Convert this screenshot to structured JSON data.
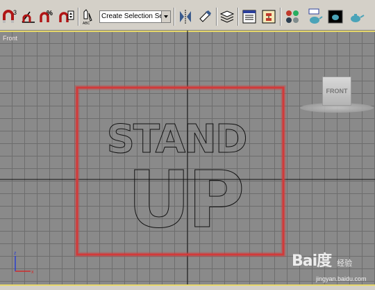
{
  "toolbar": {
    "buttons": [
      {
        "name": "snaps-toggle-3d",
        "icon": "snap-magnet-icon",
        "label": "3"
      },
      {
        "name": "angle-snap",
        "icon": "angle-snap-icon",
        "label": ""
      },
      {
        "name": "percent-snap",
        "icon": "percent-snap-icon",
        "label": "%"
      },
      {
        "name": "spinner-snap",
        "icon": "spinner-snap-icon",
        "label": ""
      },
      {
        "name": "named-selection",
        "icon": "abc-edit-named-selection-icon",
        "label": "ABC"
      },
      {
        "name": "mirror",
        "icon": "mirror-icon",
        "label": ""
      },
      {
        "name": "align",
        "icon": "align-icon",
        "label": ""
      },
      {
        "name": "layer-manager",
        "icon": "layers-icon",
        "label": ""
      },
      {
        "name": "curve-editor",
        "icon": "curve-editor-icon",
        "label": ""
      },
      {
        "name": "schematic-view",
        "icon": "schematic-view-icon",
        "label": ""
      },
      {
        "name": "material-editor",
        "icon": "material-editor-icon",
        "label": ""
      },
      {
        "name": "render-setup",
        "icon": "render-setup-teapot-icon",
        "label": ""
      },
      {
        "name": "rendered-frame",
        "icon": "rendered-frame-window-icon",
        "label": ""
      },
      {
        "name": "quick-render",
        "icon": "quick-render-teapot-icon",
        "label": ""
      }
    ],
    "selection_set": {
      "value": "Create Selection Set"
    }
  },
  "viewport": {
    "label": "Front",
    "viewcube_label": "FRONT",
    "text_object_lines": [
      "STAND",
      "UP"
    ],
    "axis": {
      "z": "z",
      "x": "x"
    },
    "colors": {
      "grid_bg": "#8a8a8a",
      "grid_line": "#6d6d6d",
      "selection_frame": "#d23a3a",
      "active_border": "#e7d86a"
    }
  },
  "watermark": {
    "brand": "Bai度",
    "sub": "经验",
    "url": "jingyan.baidu.com"
  }
}
